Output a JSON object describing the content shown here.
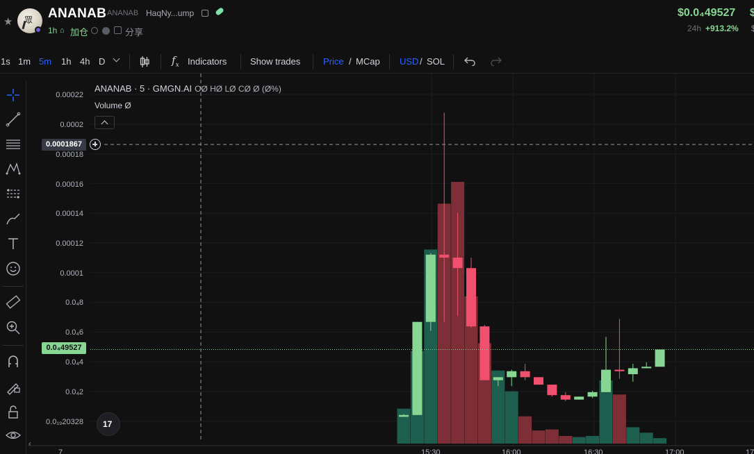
{
  "header": {
    "title": "ANANAB",
    "ticker_sub": "ANANAB",
    "contract": "HaqNy...ump",
    "age": "1h",
    "join_label": "加仓",
    "share_label": "分享",
    "price": "$0.0₄49527",
    "price_edge": "$",
    "change_label": "24h",
    "change_value": "+913.2%",
    "change_edge": "$"
  },
  "toolbar": {
    "intervals": [
      "1s",
      "1m",
      "5m",
      "1h",
      "4h",
      "D"
    ],
    "active_interval": "5m",
    "indicators_label": "Indicators",
    "show_trades_label": "Show trades",
    "price_label": "Price",
    "slash1": "/",
    "mcap_label": "MCap",
    "usd_label": "USD",
    "slash2": "/",
    "sol_label": "SOL"
  },
  "left_tools": [
    "crosshair-icon",
    "trendline-icon",
    "fib-icon",
    "pattern-icon",
    "prediction-icon",
    "brush-icon",
    "text-icon",
    "emoji-icon",
    "ruler-icon",
    "zoom-in-icon",
    "magnet-icon",
    "lock-drawing-icon",
    "lock-icon",
    "eye-icon"
  ],
  "legend": {
    "symbol": "ANANAB · 5 · GMGN.AI",
    "ohlc": "OØ HØ LØ CØ Ø (Ø%)",
    "volume": "Volume  Ø"
  },
  "y_axis": {
    "labels": [
      "0.00022",
      "0.0002",
      "0.00018",
      "0.00016",
      "0.00014",
      "0.00012",
      "0.0001",
      "0.0₄8",
      "0.0₄6",
      "0.0₄4",
      "0.0₄2",
      "0.0₁₉20328"
    ],
    "crosshair_value": "0.0001867",
    "last_price": "0.0₄49527"
  },
  "x_axis": {
    "labels": [
      "7",
      "15:30",
      "16:00",
      "16:30",
      "17:00",
      "17"
    ]
  },
  "colors": {
    "up": "#88d693",
    "down": "#f0506e",
    "up_vol": "#1e5e4e",
    "down_vol": "#7e2e37",
    "accent": "#2962ff"
  },
  "chart_data": {
    "type": "candlestick",
    "interval": "5m",
    "candles": [
      {
        "o": 4.5e-06,
        "h": 6.2e-06,
        "l": 4.5e-06,
        "c": 5.7e-06
      },
      {
        "o": 5.7e-06,
        "h": 6.8e-05,
        "l": 5.7e-06,
        "c": 6.8e-05
      },
      {
        "o": 6.8e-05,
        "h": 0.000114,
        "l": 6.2e-05,
        "c": 0.000113
      },
      {
        "o": 0.000113,
        "h": 0.000208,
        "l": 6.8e-05,
        "c": 0.000111
      },
      {
        "o": 0.000111,
        "h": 0.000141,
        "l": 7.2e-05,
        "c": 0.000104
      },
      {
        "o": 0.000104,
        "h": 0.000111,
        "l": 6.4e-05,
        "c": 6.5e-05
      },
      {
        "o": 6.5e-05,
        "h": 6.6e-05,
        "l": 2.9e-05,
        "c": 2.9e-05
      },
      {
        "o": 2.9e-05,
        "h": 3.1e-05,
        "l": 2.5e-05,
        "c": 3.1e-05
      },
      {
        "o": 3.1e-05,
        "h": 3.6e-05,
        "l": 2.5e-05,
        "c": 3.5e-05
      },
      {
        "o": 3.5e-05,
        "h": 4e-05,
        "l": 2.9e-05,
        "c": 3.1e-05
      },
      {
        "o": 3.1e-05,
        "h": 3.1e-05,
        "l": 2.6e-05,
        "c": 2.6e-05
      },
      {
        "o": 2.6e-05,
        "h": 2.6e-05,
        "l": 1.8e-05,
        "c": 1.9e-05
      },
      {
        "o": 1.9e-05,
        "h": 2.1e-05,
        "l": 1.5e-05,
        "c": 1.6e-05
      },
      {
        "o": 1.6e-05,
        "h": 1.8e-05,
        "l": 1.6e-05,
        "c": 1.8e-05
      },
      {
        "o": 1.8e-05,
        "h": 2.2e-05,
        "l": 1.7e-05,
        "c": 2.1e-05
      },
      {
        "o": 2.1e-05,
        "h": 5.8e-05,
        "l": 2.1e-05,
        "c": 3.6e-05
      },
      {
        "o": 3.6e-05,
        "h": 7e-05,
        "l": 3e-05,
        "c": 3.5e-05
      },
      {
        "o": 3.3e-05,
        "h": 4e-05,
        "l": 2.8e-05,
        "c": 3.7e-05
      },
      {
        "o": 3.7e-05,
        "h": 4.1e-05,
        "l": 3.7e-05,
        "c": 3.8e-05
      },
      {
        "o": 3.8e-05,
        "h": 4.95e-05,
        "l": 3.8e-05,
        "c": 4.95e-05
      }
    ],
    "volumes": [
      32,
      85,
      178,
      220,
      240,
      135,
      92,
      67,
      48,
      25,
      12,
      13,
      7,
      6,
      7,
      58,
      45,
      15,
      10,
      5
    ],
    "ylim": [
      1.9e-06,
      0.00022
    ],
    "last_price": 4.9527e-05,
    "crosshair_price": 0.0001867
  }
}
